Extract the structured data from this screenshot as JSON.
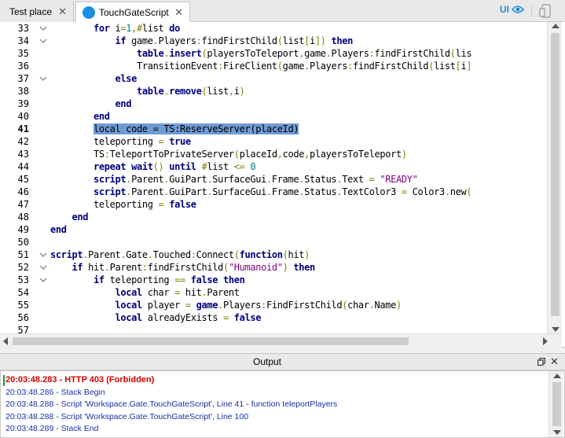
{
  "tabs": [
    {
      "label": "Test place",
      "active": false
    },
    {
      "label": "TouchGateScript",
      "active": true
    }
  ],
  "toolbar": {
    "ui_toggle_label": "UI"
  },
  "editor": {
    "first_line": 33,
    "current_line": 41,
    "lines": [
      {
        "n": "33",
        "fold": "v",
        "tokens": [
          [
            "id",
            "        "
          ],
          [
            "kw",
            "for"
          ],
          [
            "id",
            " i"
          ],
          [
            "op",
            "="
          ],
          [
            "num",
            "1"
          ],
          [
            "op",
            ",#"
          ],
          [
            "id",
            "list "
          ],
          [
            "kw",
            "do"
          ]
        ]
      },
      {
        "n": "34",
        "fold": "v",
        "tokens": [
          [
            "id",
            "            "
          ],
          [
            "kw",
            "if"
          ],
          [
            "id",
            " game"
          ],
          [
            "op",
            "."
          ],
          [
            "id",
            "Players"
          ],
          [
            "op",
            ":"
          ],
          [
            "id",
            "findFirstChild"
          ],
          [
            "op",
            "("
          ],
          [
            "id",
            "list"
          ],
          [
            "op",
            "["
          ],
          [
            "id",
            "i"
          ],
          [
            "op",
            "])"
          ],
          [
            "id",
            " "
          ],
          [
            "kw",
            "then"
          ]
        ]
      },
      {
        "n": "35",
        "fold": "",
        "tokens": [
          [
            "id",
            "                "
          ],
          [
            "kw",
            "table"
          ],
          [
            "op",
            "."
          ],
          [
            "kw",
            "insert"
          ],
          [
            "op",
            "("
          ],
          [
            "id",
            "playersToTeleport"
          ],
          [
            "op",
            ","
          ],
          [
            "id",
            "game"
          ],
          [
            "op",
            "."
          ],
          [
            "id",
            "Players"
          ],
          [
            "op",
            ":"
          ],
          [
            "id",
            "findFirstChild"
          ],
          [
            "op",
            "("
          ],
          [
            "id",
            "lis"
          ]
        ]
      },
      {
        "n": "36",
        "fold": "",
        "tokens": [
          [
            "id",
            "                TransitionEvent"
          ],
          [
            "op",
            ":"
          ],
          [
            "id",
            "FireClient"
          ],
          [
            "op",
            "("
          ],
          [
            "id",
            "game"
          ],
          [
            "op",
            "."
          ],
          [
            "id",
            "Players"
          ],
          [
            "op",
            ":"
          ],
          [
            "id",
            "findFirstChild"
          ],
          [
            "op",
            "("
          ],
          [
            "id",
            "list"
          ],
          [
            "op",
            "["
          ],
          [
            "id",
            "i"
          ],
          [
            "op",
            "]"
          ]
        ]
      },
      {
        "n": "37",
        "fold": "v",
        "tokens": [
          [
            "id",
            "            "
          ],
          [
            "kw",
            "else"
          ]
        ]
      },
      {
        "n": "38",
        "fold": "",
        "tokens": [
          [
            "id",
            "                "
          ],
          [
            "kw",
            "table"
          ],
          [
            "op",
            "."
          ],
          [
            "kw",
            "remove"
          ],
          [
            "op",
            "("
          ],
          [
            "id",
            "list"
          ],
          [
            "op",
            ","
          ],
          [
            "id",
            "i"
          ],
          [
            "op",
            ")"
          ]
        ]
      },
      {
        "n": "39",
        "fold": "",
        "tokens": [
          [
            "id",
            "            "
          ],
          [
            "kw",
            "end"
          ]
        ]
      },
      {
        "n": "40",
        "fold": "",
        "tokens": [
          [
            "id",
            "        "
          ],
          [
            "kw",
            "end"
          ]
        ]
      },
      {
        "n": "41",
        "fold": "",
        "tokens": [
          [
            "id",
            "        "
          ],
          [
            "hl",
            "local code = TS:ReserveServer(placeId)"
          ]
        ]
      },
      {
        "n": "42",
        "fold": "",
        "tokens": [
          [
            "id",
            "        teleporting "
          ],
          [
            "op",
            "="
          ],
          [
            "id",
            " "
          ],
          [
            "kw",
            "true"
          ]
        ]
      },
      {
        "n": "43",
        "fold": "",
        "tokens": [
          [
            "id",
            "        TS"
          ],
          [
            "op",
            ":"
          ],
          [
            "id",
            "TeleportToPrivateServer"
          ],
          [
            "op",
            "("
          ],
          [
            "id",
            "placeId"
          ],
          [
            "op",
            ","
          ],
          [
            "id",
            "code"
          ],
          [
            "op",
            ","
          ],
          [
            "id",
            "playersToTeleport"
          ],
          [
            "op",
            ")"
          ]
        ]
      },
      {
        "n": "44",
        "fold": "",
        "tokens": [
          [
            "id",
            "        "
          ],
          [
            "kw",
            "repeat"
          ],
          [
            "id",
            " "
          ],
          [
            "kw",
            "wait"
          ],
          [
            "op",
            "()"
          ],
          [
            "id",
            " "
          ],
          [
            "kw",
            "until"
          ],
          [
            "id",
            " "
          ],
          [
            "op",
            "#"
          ],
          [
            "id",
            "list "
          ],
          [
            "op",
            "<="
          ],
          [
            "id",
            " "
          ],
          [
            "num",
            "0"
          ]
        ]
      },
      {
        "n": "45",
        "fold": "",
        "tokens": [
          [
            "id",
            "        "
          ],
          [
            "kw",
            "script"
          ],
          [
            "op",
            "."
          ],
          [
            "id",
            "Parent"
          ],
          [
            "op",
            "."
          ],
          [
            "id",
            "GuiPart"
          ],
          [
            "op",
            "."
          ],
          [
            "id",
            "SurfaceGui"
          ],
          [
            "op",
            "."
          ],
          [
            "id",
            "Frame"
          ],
          [
            "op",
            "."
          ],
          [
            "id",
            "Status"
          ],
          [
            "op",
            "."
          ],
          [
            "id",
            "Text "
          ],
          [
            "op",
            "="
          ],
          [
            "id",
            " "
          ],
          [
            "str",
            "\"READY\""
          ]
        ]
      },
      {
        "n": "46",
        "fold": "",
        "tokens": [
          [
            "id",
            "        "
          ],
          [
            "kw",
            "script"
          ],
          [
            "op",
            "."
          ],
          [
            "id",
            "Parent"
          ],
          [
            "op",
            "."
          ],
          [
            "id",
            "GuiPart"
          ],
          [
            "op",
            "."
          ],
          [
            "id",
            "SurfaceGui"
          ],
          [
            "op",
            "."
          ],
          [
            "id",
            "Frame"
          ],
          [
            "op",
            "."
          ],
          [
            "id",
            "Status"
          ],
          [
            "op",
            "."
          ],
          [
            "id",
            "TextColor3 "
          ],
          [
            "op",
            "="
          ],
          [
            "id",
            " Color3"
          ],
          [
            "op",
            "."
          ],
          [
            "id",
            "new"
          ],
          [
            "op",
            "("
          ]
        ]
      },
      {
        "n": "47",
        "fold": "",
        "tokens": [
          [
            "id",
            "        teleporting "
          ],
          [
            "op",
            "="
          ],
          [
            "id",
            " "
          ],
          [
            "kw",
            "false"
          ]
        ]
      },
      {
        "n": "48",
        "fold": "",
        "tokens": [
          [
            "id",
            "    "
          ],
          [
            "kw",
            "end"
          ]
        ]
      },
      {
        "n": "49",
        "fold": "",
        "tokens": [
          [
            "kw",
            "end"
          ]
        ]
      },
      {
        "n": "50",
        "fold": "",
        "tokens": []
      },
      {
        "n": "51",
        "fold": "v",
        "tokens": [
          [
            "kw",
            "script"
          ],
          [
            "op",
            "."
          ],
          [
            "id",
            "Parent"
          ],
          [
            "op",
            "."
          ],
          [
            "id",
            "Gate"
          ],
          [
            "op",
            "."
          ],
          [
            "id",
            "Touched"
          ],
          [
            "op",
            ":"
          ],
          [
            "id",
            "Connect"
          ],
          [
            "op",
            "("
          ],
          [
            "kw",
            "function"
          ],
          [
            "op",
            "("
          ],
          [
            "id",
            "hit"
          ],
          [
            "op",
            ")"
          ]
        ]
      },
      {
        "n": "52",
        "fold": "v",
        "tokens": [
          [
            "id",
            "    "
          ],
          [
            "kw",
            "if"
          ],
          [
            "id",
            " hit"
          ],
          [
            "op",
            "."
          ],
          [
            "id",
            "Parent"
          ],
          [
            "op",
            ":"
          ],
          [
            "id",
            "findFirstChild"
          ],
          [
            "op",
            "("
          ],
          [
            "str",
            "\"Humanoid\""
          ],
          [
            "op",
            ")"
          ],
          [
            "id",
            " "
          ],
          [
            "kw",
            "then"
          ]
        ]
      },
      {
        "n": "53",
        "fold": "v",
        "tokens": [
          [
            "id",
            "        "
          ],
          [
            "kw",
            "if"
          ],
          [
            "id",
            " teleporting "
          ],
          [
            "op",
            "=="
          ],
          [
            "id",
            " "
          ],
          [
            "kw",
            "false"
          ],
          [
            "id",
            " "
          ],
          [
            "kw",
            "then"
          ]
        ]
      },
      {
        "n": "54",
        "fold": "",
        "tokens": [
          [
            "id",
            "            "
          ],
          [
            "kw",
            "local"
          ],
          [
            "id",
            " char "
          ],
          [
            "op",
            "="
          ],
          [
            "id",
            " hit"
          ],
          [
            "op",
            "."
          ],
          [
            "id",
            "Parent"
          ]
        ]
      },
      {
        "n": "55",
        "fold": "",
        "tokens": [
          [
            "id",
            "            "
          ],
          [
            "kw",
            "local"
          ],
          [
            "id",
            " player "
          ],
          [
            "op",
            "="
          ],
          [
            "id",
            " "
          ],
          [
            "kw",
            "game"
          ],
          [
            "op",
            "."
          ],
          [
            "id",
            "Players"
          ],
          [
            "op",
            ":"
          ],
          [
            "id",
            "FindFirstChild"
          ],
          [
            "op",
            "("
          ],
          [
            "id",
            "char"
          ],
          [
            "op",
            "."
          ],
          [
            "id",
            "Name"
          ],
          [
            "op",
            ")"
          ]
        ]
      },
      {
        "n": "56",
        "fold": "",
        "tokens": [
          [
            "id",
            "            "
          ],
          [
            "kw",
            "local"
          ],
          [
            "id",
            " alreadyExists "
          ],
          [
            "op",
            "="
          ],
          [
            "id",
            " "
          ],
          [
            "kw",
            "false"
          ]
        ]
      },
      {
        "n": "57",
        "fold": "",
        "tokens": []
      }
    ]
  },
  "output": {
    "title": "Output",
    "lines": [
      {
        "text": "20:03:48.283 - HTTP 403 (Forbidden)",
        "kind": "error"
      },
      {
        "text": "20:03:48.286 - Stack Begin",
        "kind": "info"
      },
      {
        "text": "20:03:48.288 - Script 'Workspace.Gate.TouchGateScript', Line 41 - function teleportPlayers",
        "kind": "info"
      },
      {
        "text": "20:03:48.288 - Script 'Workspace.Gate.TouchGateScript', Line 100",
        "kind": "info"
      },
      {
        "text": "20:03:48.289 - Stack End",
        "kind": "info"
      }
    ]
  },
  "colors": {
    "accent": "#1d8fe1",
    "keyword": "#00007f",
    "string": "#7f007f",
    "number": "#007f7f",
    "operator": "#7f7f00",
    "selection": "#6f9bd4",
    "error": "#d40000",
    "output_info": "#1a2fa8"
  }
}
